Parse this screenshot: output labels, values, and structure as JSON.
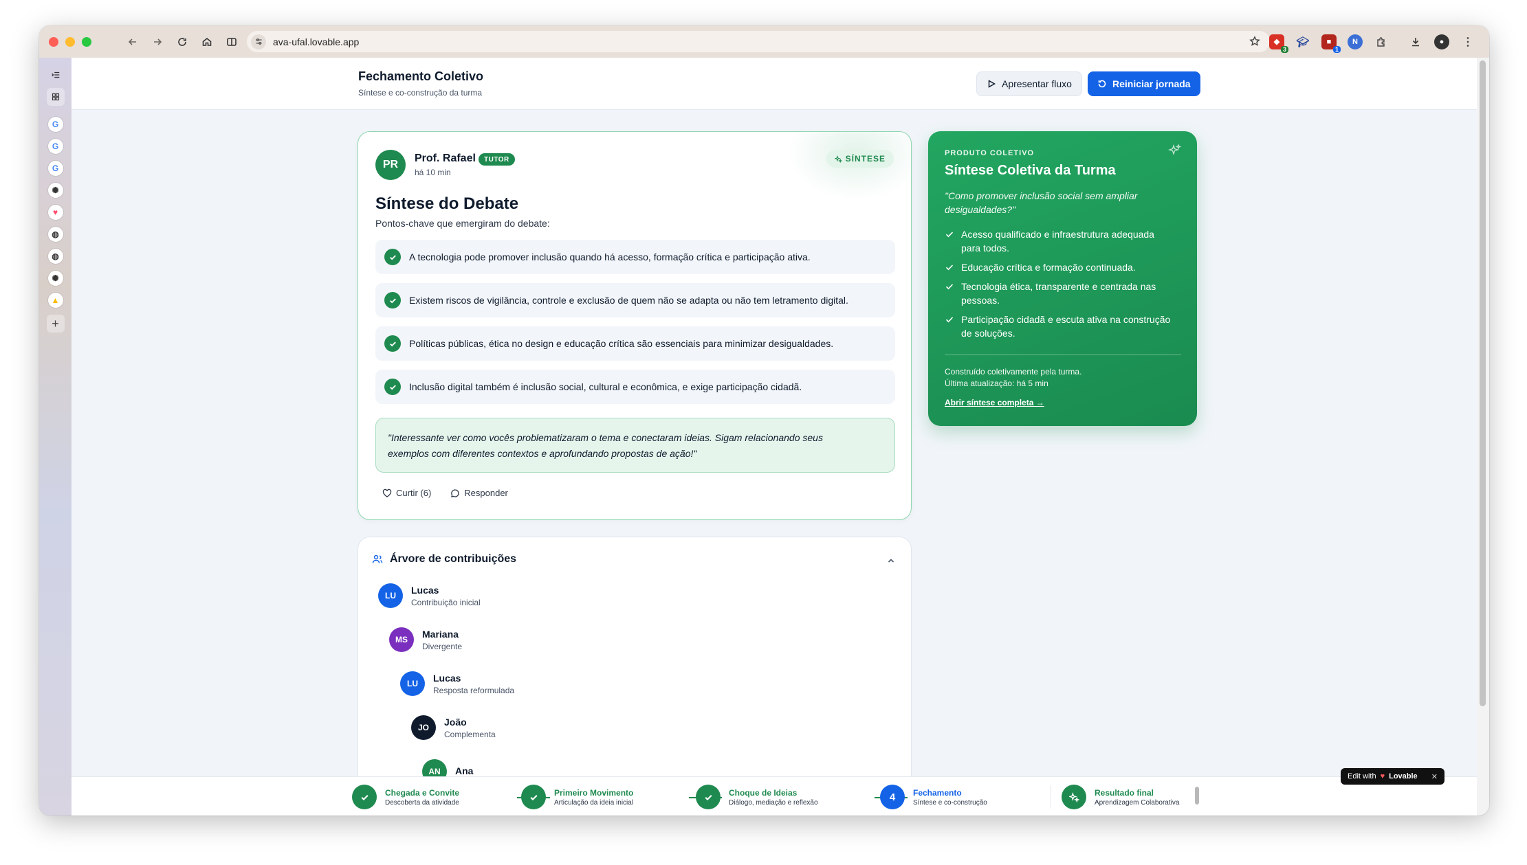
{
  "browser": {
    "url": "ava-ufal.lovable.app",
    "extensions": [
      {
        "icon": "ext-red-icon",
        "badge": "3",
        "color": "#d93025"
      },
      {
        "icon": "graduation-cap-icon",
        "badge": "",
        "color": "#2b4a9c"
      },
      {
        "icon": "ext-dark-icon",
        "badge": "1",
        "color": "#b3261e"
      },
      {
        "icon": "n-extension-icon",
        "badge": "",
        "color": "#3b6fd6"
      },
      {
        "icon": "puzzle-icon",
        "badge": "",
        "color": "#555555"
      },
      {
        "icon": "download-icon",
        "badge": "",
        "color": "#555555"
      },
      {
        "icon": "profile-icon",
        "badge": "",
        "color": "#333333"
      },
      {
        "icon": "more-icon",
        "badge": "",
        "color": "#555555"
      }
    ]
  },
  "header": {
    "title": "Fechamento Coletivo",
    "subtitle": "Síntese e co-construção da turma",
    "present_button": "Apresentar fluxo",
    "restart_button": "Reiniciar jornada"
  },
  "synthesis": {
    "avatar": "PR",
    "author": "Prof. Rafael",
    "badge": "TUTOR",
    "time": "há 10 min",
    "pill": "SÍNTESE",
    "title": "Síntese do Debate",
    "subtitle": "Pontos-chave que emergiram do debate:",
    "points": [
      "A tecnologia pode promover inclusão quando há acesso, formação crítica e participação ativa.",
      "Existem riscos de vigilância, controle e exclusão de quem não se adapta ou não tem letramento digital.",
      "Políticas públicas, ética no design e educação crítica são essenciais para minimizar desigualdades.",
      "Inclusão digital também é inclusão social, cultural e econômica, e exige participação cidadã."
    ],
    "quote_line1": "\"Interessante ver como vocês problematizaram o tema e conectaram ideias. Sigam relacionando seus",
    "quote_line2": "exemplos com diferentes contextos e aprofundando propostas de ação!\"",
    "like": "Curtir (6)",
    "reply": "Responder"
  },
  "product": {
    "kicker": "PRODUTO COLETIVO",
    "title": "Síntese Coletiva da Turma",
    "question_line1": "\"Como promover inclusão social sem ampliar",
    "question_line2": "desigualdades?\"",
    "items": [
      {
        "line1": "Acesso qualificado e infraestrutura adequada",
        "line2": "para todos."
      },
      {
        "line1": "Educação crítica e formação continuada.",
        "line2": ""
      },
      {
        "line1": "Tecnologia ética, transparente e centrada nas",
        "line2": "pessoas."
      },
      {
        "line1": "Participação cidadã e escuta ativa na construção",
        "line2": "de soluções."
      }
    ],
    "footer1": "Construído coletivamente pela turma.",
    "footer2": "Última atualização: há 5 min",
    "link": "Abrir síntese completa →"
  },
  "tree": {
    "title": "Árvore de contribuições",
    "nodes": [
      {
        "initials": "LU",
        "name": "Lucas",
        "role": "Contribuição inicial",
        "color": "#1463e6"
      },
      {
        "initials": "MS",
        "name": "Mariana",
        "role": "Divergente",
        "color": "#7b2fbe"
      },
      {
        "initials": "LU",
        "name": "Lucas",
        "role": "Resposta reformulada",
        "color": "#1463e6"
      },
      {
        "initials": "JO",
        "name": "João",
        "role": "Complementa",
        "color": "#0f1b2d"
      },
      {
        "initials": "AN",
        "name": "Ana",
        "role": "",
        "color": "#1f8a4f"
      }
    ]
  },
  "steps": [
    {
      "name": "Chegada e Convite",
      "desc": "Descoberta da atividade",
      "state": "done",
      "number": ""
    },
    {
      "name": "Primeiro Movimento",
      "desc": "Articulação da ideia inicial",
      "state": "done",
      "number": ""
    },
    {
      "name": "Choque de Ideias",
      "desc": "Diálogo, mediação e reflexão",
      "state": "done",
      "number": ""
    },
    {
      "name": "Fechamento",
      "desc": "Síntese e co-construção",
      "state": "current",
      "number": "4"
    },
    {
      "name": "Resultado final",
      "desc": "Aprendizagem Colaborativa",
      "state": "done",
      "number": ""
    }
  ],
  "lovable": {
    "label": "Edit with",
    "brand": "Lovable"
  },
  "colors": {
    "green": "#1f8a4f",
    "blue": "#1463e6",
    "purple": "#7b2fbe",
    "navy": "#0f1b2d"
  }
}
